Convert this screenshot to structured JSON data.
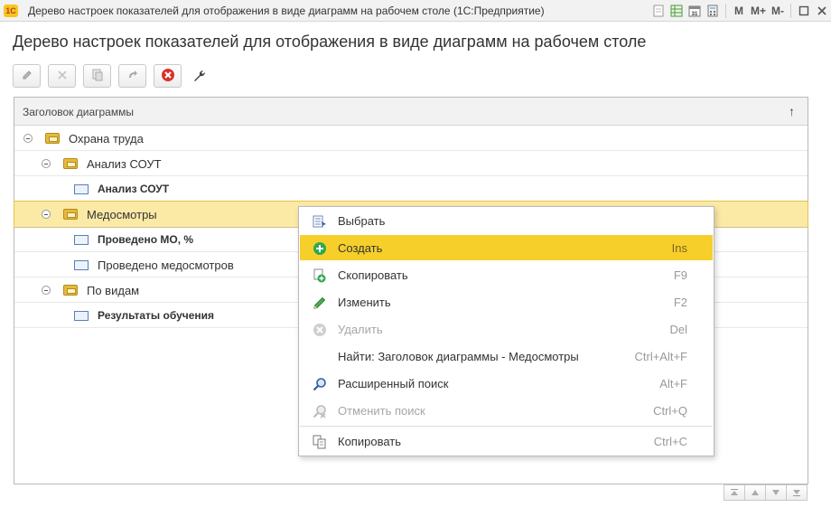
{
  "window": {
    "app_logo": "1С",
    "title": "Дерево настроек показателей для отображения в виде диаграмм на рабочем столе  (1С:Предприятие)",
    "buttons": [
      "M",
      "M+",
      "M-"
    ]
  },
  "form": {
    "title": "Дерево настроек показателей для отображения в виде диаграмм на рабочем столе"
  },
  "toolbar": {
    "icons": [
      "pencil-icon",
      "delete-icon",
      "copy-icon",
      "move-icon",
      "close-red-icon",
      "wrench-icon"
    ]
  },
  "table": {
    "column_header": "Заголовок диаграммы",
    "sort_indicator": "↑",
    "rows": [
      {
        "label": "Охрана труда",
        "type": "group",
        "level": 0
      },
      {
        "label": "Анализ СОУТ",
        "type": "group",
        "level": 1
      },
      {
        "label": "Анализ СОУТ",
        "type": "item",
        "level": 2,
        "bold": true
      },
      {
        "label": "Медосмотры",
        "type": "group",
        "level": 1,
        "selected": true
      },
      {
        "label": "Проведено МО, %",
        "type": "item",
        "level": 2,
        "bold": true
      },
      {
        "label": "Проведено медосмотров",
        "type": "item",
        "level": 2,
        "bold": false
      },
      {
        "label": "По видам",
        "type": "group",
        "level": 1
      },
      {
        "label": "Результаты обучения",
        "type": "item",
        "level": 2,
        "bold": true
      }
    ]
  },
  "context_menu": {
    "items": [
      {
        "label": "Выбрать",
        "shortcut": "",
        "icon": "select-list-icon"
      },
      {
        "label": "Создать",
        "shortcut": "Ins",
        "icon": "add-green-icon",
        "active": true
      },
      {
        "label": "Скопировать",
        "shortcut": "F9",
        "icon": "copy-add-icon"
      },
      {
        "label": "Изменить",
        "shortcut": "F2",
        "icon": "pencil-icon"
      },
      {
        "label": "Удалить",
        "shortcut": "Del",
        "icon": "delete-grey-icon",
        "disabled": true
      },
      {
        "label": "Найти: Заголовок диаграммы - Медосмотры",
        "shortcut": "Ctrl+Alt+F",
        "icon": ""
      },
      {
        "label": "Расширенный поиск",
        "shortcut": "Alt+F",
        "icon": "search-icon"
      },
      {
        "label": "Отменить поиск",
        "shortcut": "Ctrl+Q",
        "icon": "cancel-search-icon",
        "disabled": true
      },
      {
        "label": "Копировать",
        "shortcut": "Ctrl+C",
        "icon": "copy-clipboard-icon"
      }
    ]
  },
  "colors": {
    "selected_row": "#fbe9a6",
    "menu_highlight": "#f7cf2b",
    "folder": "#e5ba3c"
  }
}
